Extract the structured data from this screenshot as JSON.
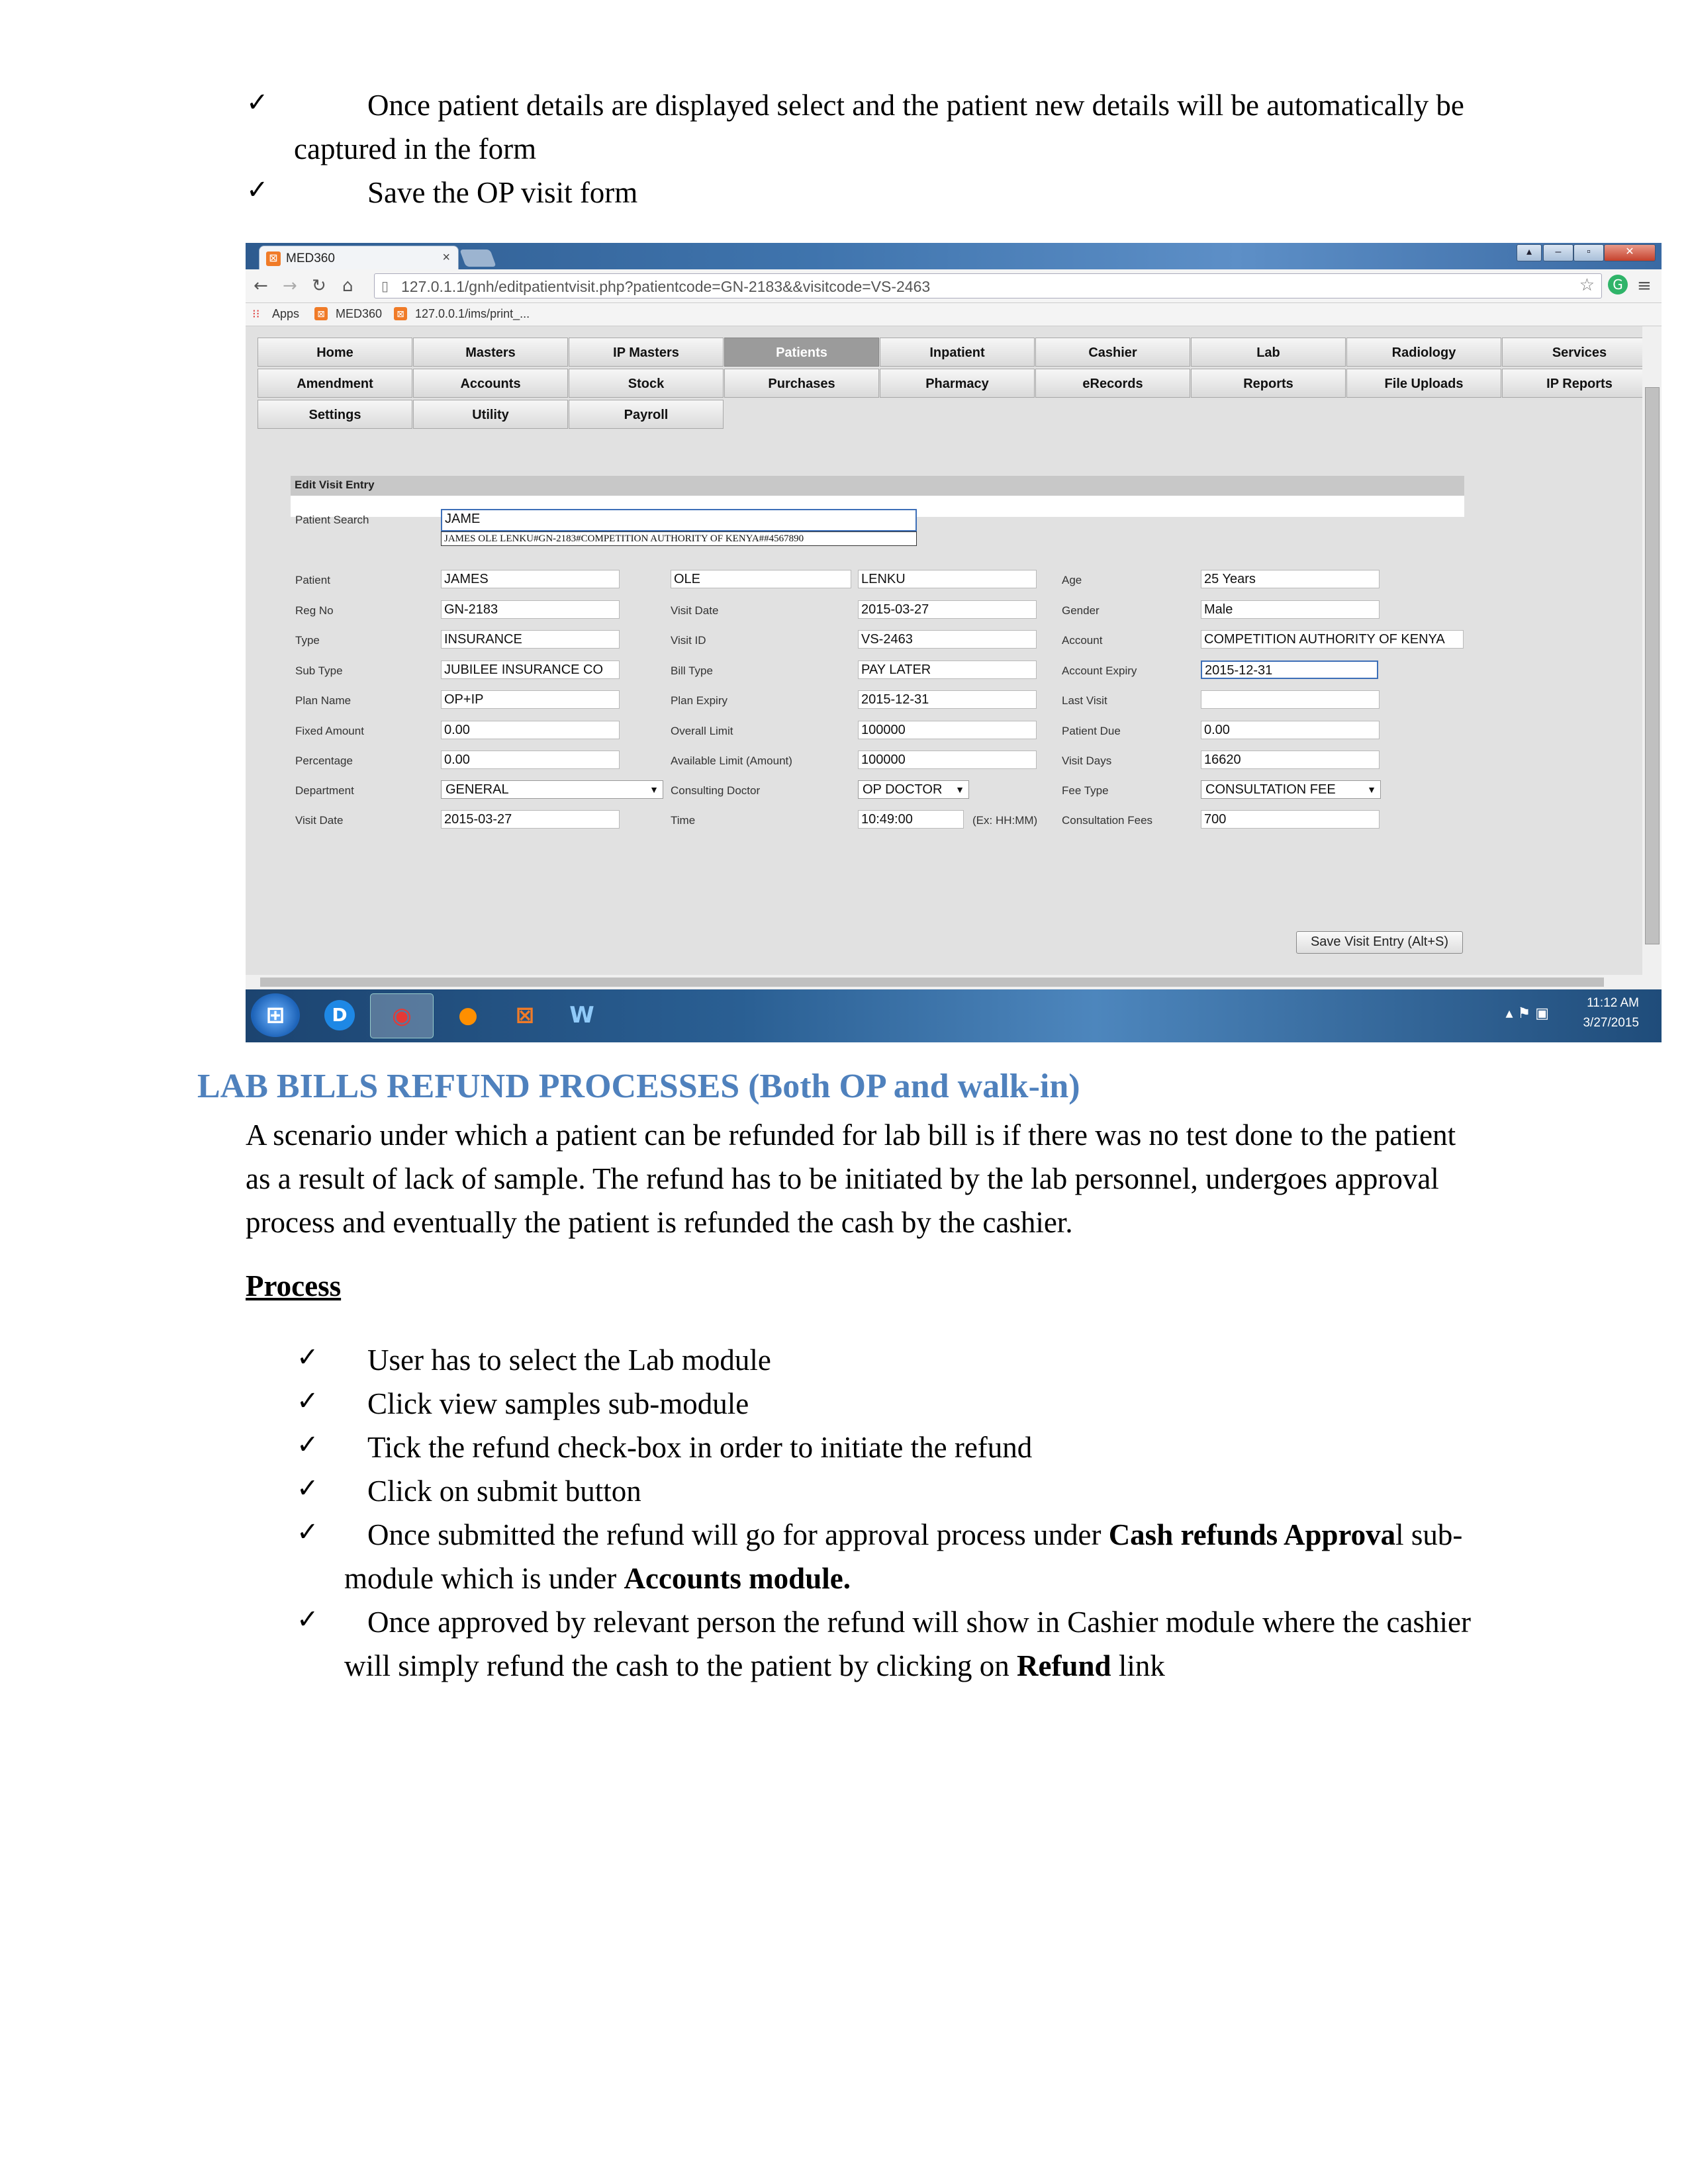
{
  "doc": {
    "check_glyph": "✓",
    "bullets_top": [
      {
        "line1": "Once patient details are displayed select and the patient new details will be automatically be",
        "line2": "captured in the form"
      },
      {
        "line1": "Save the OP visit form"
      }
    ],
    "section_heading": "LAB BILLS REFUND PROCESSES (Both OP and walk-in)",
    "intro": [
      "A scenario under which a patient can be refunded for lab bill is if there was no test done to the patient",
      "as a result of lack of sample. The refund has to be initiated by the lab personnel, undergoes approval",
      "process and eventually the patient is refunded the cash by the cashier."
    ],
    "process_heading": "Process",
    "steps": [
      "User has to select the Lab module",
      "Click view samples sub-module",
      "Tick the refund check-box in order to initiate the refund",
      "Click on submit button"
    ],
    "step5": {
      "pre": "Once submitted the refund will go for approval process under ",
      "bold": "Cash refunds Approva",
      "post": "l sub-",
      "line2_pre": "module which is under ",
      "line2_bold": "Accounts module."
    },
    "step6": {
      "line1": "Once approved by relevant person the refund will show in Cashier module where the cashier",
      "line2_pre": "will simply refund the cash to the patient by clicking on ",
      "line2_bold": "Refund",
      "line2_post": " link"
    }
  },
  "browser": {
    "tab_title": "MED360",
    "tab_close": "×",
    "url": "127.0.1.1/gnh/editpatientvisit.php?patientcode=GN-2183&&visitcode=VS-2463",
    "bookmarks": [
      "Apps",
      "MED360",
      "127.0.0.1/ims/print_..."
    ],
    "nav_icons": [
      "back-icon",
      "forward-icon",
      "reload-icon",
      "home-icon"
    ]
  },
  "menu": {
    "row1": [
      "Home",
      "Masters",
      "IP Masters",
      "Patients",
      "Inpatient",
      "Cashier",
      "Lab",
      "Radiology",
      "Services"
    ],
    "row2": [
      "Amendment",
      "Accounts",
      "Stock",
      "Purchases",
      "Pharmacy",
      "eRecords",
      "Reports",
      "File Uploads",
      "IP Reports"
    ],
    "row3": [
      "Settings",
      "Utility",
      "Payroll"
    ],
    "active": "Patients"
  },
  "form": {
    "title": "Edit Visit Entry",
    "search_label": "Patient Search",
    "search_value": "JAME",
    "search_suggestion": "JAMES OLE LENKU#GN-2183#COMPETITION AUTHORITY OF KENYA##4567890",
    "labels": {
      "patient": "Patient",
      "reg_no": "Reg No",
      "type": "Type",
      "sub_type": "Sub Type",
      "plan_name": "Plan Name",
      "fixed_amount": "Fixed Amount",
      "percentage": "Percentage",
      "department": "Department",
      "visit_date": "Visit Date",
      "visit_date2": "Visit Date",
      "visit_id": "Visit ID",
      "bill_type": "Bill Type",
      "plan_expiry": "Plan Expiry",
      "overall_limit": "Overall Limit",
      "available_limit": "Available Limit (Amount)",
      "consulting_doctor": "Consulting Doctor",
      "time": "Time",
      "age": "Age",
      "gender": "Gender",
      "account": "Account",
      "account_expiry": "Account Expiry",
      "last_visit": "Last Visit",
      "patient_due": "Patient Due",
      "visit_days": "Visit Days",
      "fee_type": "Fee Type",
      "consultation_fees": "Consultation Fees"
    },
    "values": {
      "first_name": "JAMES",
      "middle_name": "OLE",
      "last_name": "LENKU",
      "reg_no": "GN-2183",
      "type": "INSURANCE",
      "sub_type": "JUBILEE INSURANCE CO",
      "plan_name": "OP+IP",
      "fixed_amount": "0.00",
      "percentage": "0.00",
      "department": "GENERAL",
      "visit_date": "2015-03-27",
      "visit_date2": "2015-03-27",
      "visit_id": "VS-2463",
      "bill_type": "PAY LATER",
      "plan_expiry": "2015-12-31",
      "overall_limit": "100000",
      "available_limit": "100000",
      "consulting_doctor": "OP DOCTOR",
      "time": "10:49:00",
      "time_hint": "(Ex: HH:MM)",
      "age": "25 Years",
      "gender": "Male",
      "account": "COMPETITION AUTHORITY OF KENYA",
      "account_expiry": "2015-12-31",
      "last_visit": "",
      "patient_due": "0.00",
      "visit_days": "16620",
      "fee_type": "CONSULTATION FEE",
      "consultation_fees": "700"
    },
    "save_button": "Save Visit Entry (Alt+S)"
  },
  "taskbar": {
    "clock_time": "11:12 AM",
    "clock_date": "3/27/2015",
    "apps": [
      "windows-start-icon",
      "d-app-icon",
      "chrome-icon",
      "firefox-icon",
      "med360-icon",
      "word-icon"
    ]
  }
}
